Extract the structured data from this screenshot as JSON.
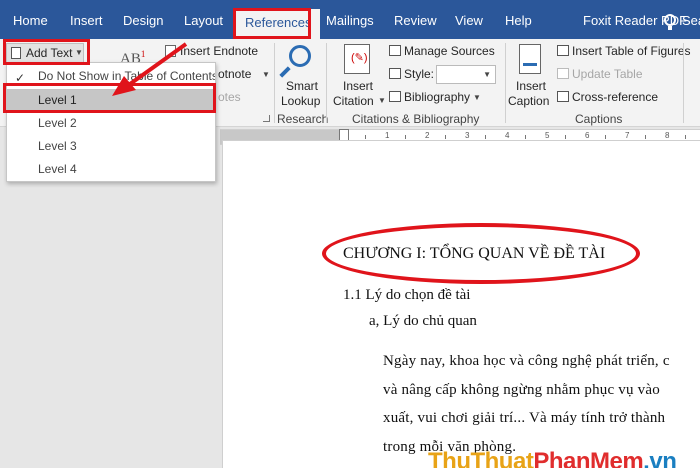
{
  "tabs": [
    "Home",
    "Insert",
    "Design",
    "Layout",
    "References",
    "Mailings",
    "Review",
    "View",
    "Help",
    "Foxit Reader PDF"
  ],
  "tell_me": "Sea",
  "ribbon": {
    "add_text": "Add Text",
    "insert_endnote": "Insert Endnote",
    "next_footnote": "otnote",
    "show_notes": "otes",
    "smart_lookup_1": "Smart",
    "smart_lookup_2": "Lookup",
    "insert_citation_1": "Insert",
    "insert_citation_2": "Citation",
    "manage_sources": "Manage Sources",
    "style_label": "Style:",
    "bibliography": "Bibliography",
    "insert_caption_1": "Insert",
    "insert_caption_2": "Caption",
    "insert_table_of_figures": "Insert Table of Figures",
    "update_table": "Update Table",
    "cross_reference": "Cross-reference",
    "groups": {
      "research": "Research",
      "citations": "Citations & Bibliography",
      "captions": "Captions"
    }
  },
  "dropdown": {
    "items": [
      "Do Not Show in Table of Contents",
      "Level 1",
      "Level 2",
      "Level 3",
      "Level 4"
    ],
    "checked_index": 0,
    "selected_index": 1
  },
  "ruler_numbers": [
    "1",
    "2",
    "3",
    "4",
    "5",
    "6",
    "7",
    "8"
  ],
  "document": {
    "heading": "CHƯƠNG I: TỔNG QUAN VỀ ĐỀ TÀI",
    "section": "1.1 Lý do chọn đề tài",
    "subsection": "a, Lý do chủ quan",
    "paragraph_lines": [
      "Ngày nay, khoa học và công nghệ phát triển, c",
      "và nâng cấp không ngừng nhằm phục vụ vào",
      "xuất, vui chơi giải trí... Và máy tính trở thành",
      "trong mỗi văn phòng."
    ]
  },
  "watermark": {
    "part1": "Thu",
    "part2": "Thuat",
    "part3": "PhanMem",
    "part4": ".vn"
  },
  "colors": {
    "ribbon_blue": "#2b579a",
    "highlight_red": "#e0141b",
    "selected_gray": "#c6c6c6"
  }
}
